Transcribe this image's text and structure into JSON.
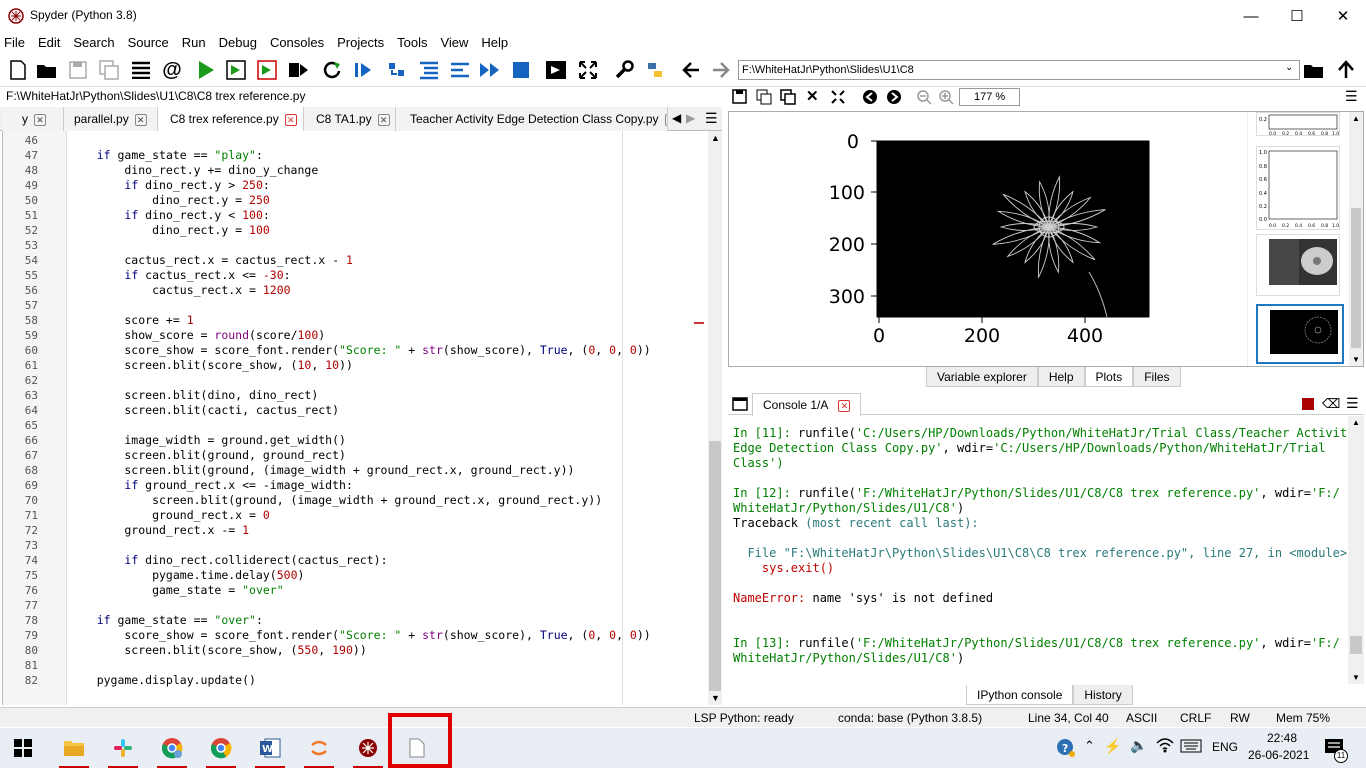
{
  "window": {
    "title": "Spyder (Python 3.8)"
  },
  "menu": [
    "File",
    "Edit",
    "Search",
    "Source",
    "Run",
    "Debug",
    "Consoles",
    "Projects",
    "Tools",
    "View",
    "Help"
  ],
  "toolbar": {
    "path": "F:\\WhiteHatJr\\Python\\Slides\\U1\\C8"
  },
  "editor": {
    "file_path": "F:\\WhiteHatJr\\Python\\Slides\\U1\\C8\\C8 trex reference.py",
    "tabs": [
      {
        "label": "y",
        "close": "✕"
      },
      {
        "label": "parallel.py",
        "close": "✕"
      },
      {
        "label": "C8 trex reference.py",
        "close": "✕"
      },
      {
        "label": "C8 TA1.py",
        "close": "✕"
      },
      {
        "label": "Teacher Activity Edge Detection Class Copy.py",
        "close": "✕"
      }
    ],
    "line_numbers": [
      "46",
      "47",
      "48",
      "49",
      "50",
      "51",
      "52",
      "53",
      "54",
      "55",
      "56",
      "57",
      "58",
      "59",
      "60",
      "61",
      "62",
      "63",
      "64",
      "65",
      "66",
      "67",
      "68",
      "69",
      "70",
      "71",
      "72",
      "73",
      "74",
      "75",
      "76",
      "77",
      "78",
      "79",
      "80",
      "81",
      "82"
    ],
    "lines": [
      "",
      "    if game_state == \"play\":",
      "        dino_rect.y += dino_y_change",
      "        if dino_rect.y > 250:",
      "            dino_rect.y = 250",
      "        if dino_rect.y < 100:",
      "            dino_rect.y = 100",
      "",
      "        cactus_rect.x = cactus_rect.x - 1",
      "        if cactus_rect.x <= -30:",
      "            cactus_rect.x = 1200",
      "",
      "        score += 1",
      "        show_score = round(score/100)",
      "        score_show = score_font.render(\"Score: \" + str(show_score), True, (0, 0, 0))",
      "        screen.blit(score_show, (10, 10))",
      "",
      "        screen.blit(dino, dino_rect)",
      "        screen.blit(cacti, cactus_rect)",
      "",
      "        image_width = ground.get_width()",
      "        screen.blit(ground, ground_rect)",
      "        screen.blit(ground, (image_width + ground_rect.x, ground_rect.y))",
      "        if ground_rect.x <= -image_width:",
      "            screen.blit(ground, (image_width + ground_rect.x, ground_rect.y))",
      "            ground_rect.x = 0",
      "        ground_rect.x -= 1",
      "",
      "        if dino_rect.colliderect(cactus_rect):",
      "            pygame.time.delay(500)",
      "            game_state = \"over\"",
      "",
      "    if game_state == \"over\":",
      "        score_show = score_font.render(\"Score: \" + str(show_score), True, (0, 0, 0))",
      "        screen.blit(score_show, (550, 190))",
      "",
      "    pygame.display.update()"
    ]
  },
  "plots": {
    "zoom": "177 %",
    "y_ticks": [
      "0",
      "100",
      "200",
      "300"
    ],
    "x_ticks": [
      "0",
      "200",
      "400"
    ],
    "thumb_ticks_y": [
      "0.2",
      "1.0",
      "0.8",
      "0.6",
      "0.4",
      "0.2",
      "0.0"
    ],
    "thumb_ticks_x": [
      "0.0",
      "0.2",
      "0.4",
      "0.6",
      "0.8",
      "1.0"
    ],
    "pane_tabs": [
      "Variable explorer",
      "Help",
      "Plots",
      "Files"
    ]
  },
  "console": {
    "tab": "Console 1/A",
    "lines": [
      {
        "prompt": "In [11]: ",
        "text": "runfile(",
        "s": "'C:/Users/HP/Downloads/Python/WhiteHatJr/Trial Class/Teacher Activity"
      },
      {
        "text": "Edge Detection Class Copy.py'",
        "s2": ", wdir=",
        "s3": "'C:/Users/HP/Downloads/Python/WhiteHatJr/Trial"
      },
      {
        "s": "Class')"
      },
      {
        "prompt": "In [12]: ",
        "text": "runfile(",
        "s": "'F:/WhiteHatJr/Python/Slides/U1/C8/C8 trex reference.py'",
        "s2": ", wdir=",
        "s3": "'F:/"
      },
      {
        "s": "WhiteHatJr/Python/Slides/U1/C8'",
        "text": ")"
      },
      {
        "text": "Traceback ",
        "s": "(most recent call last):"
      },
      {
        "text": "  File \"F:\\WhiteHatJr\\Python\\Slides\\U1\\C8\\C8 trex reference.py\", line 27, in <module>"
      },
      {
        "text": "    sys.exit()"
      },
      {
        "err": "NameError:",
        "text": " name 'sys' is not defined"
      },
      {
        "prompt": "In [13]: ",
        "text": "runfile(",
        "s": "'F:/WhiteHatJr/Python/Slides/U1/C8/C8 trex reference.py'",
        "s2": ", wdir=",
        "s3": "'F:/"
      },
      {
        "s": "WhiteHatJr/Python/Slides/U1/C8'",
        "text": ")"
      }
    ],
    "bottom_tabs": [
      "IPython console",
      "History"
    ]
  },
  "status": {
    "lsp": "LSP Python: ready",
    "conda": "conda: base (Python 3.8.5)",
    "position": "Line 34, Col 40",
    "encoding": "ASCII",
    "eol": "CRLF",
    "rw": "RW",
    "mem": "Mem 75%"
  },
  "taskbar": {
    "time": "22:48",
    "date": "26-06-2021",
    "lang": "ENG",
    "notif": "11"
  }
}
